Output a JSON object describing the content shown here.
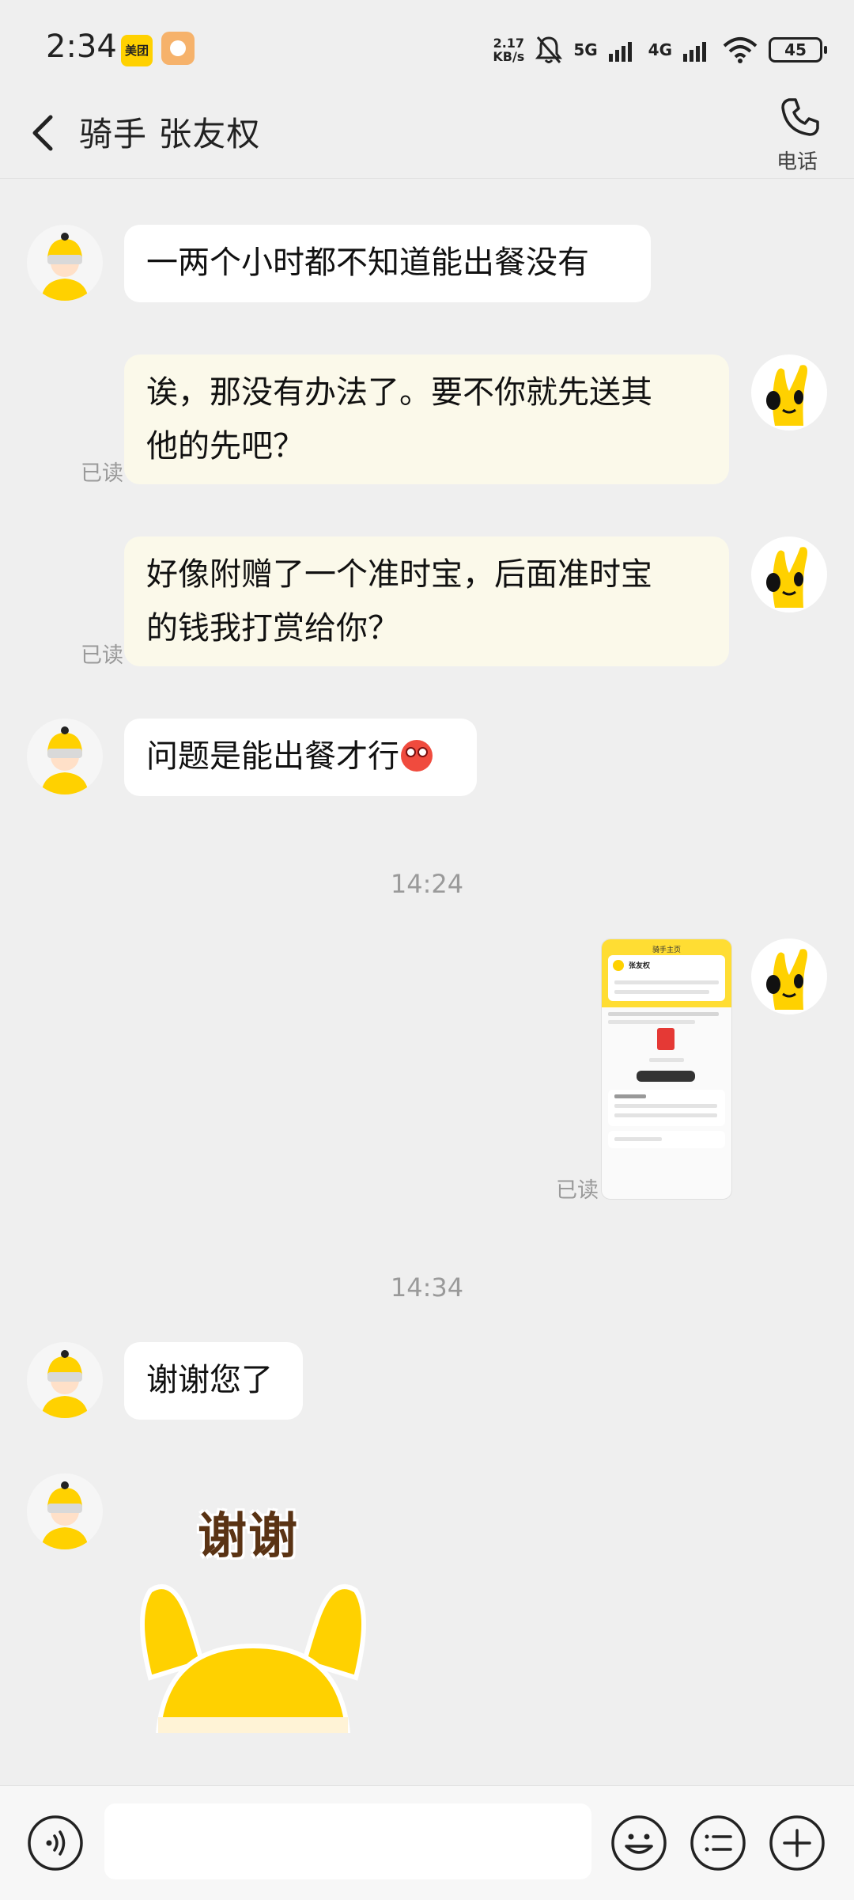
{
  "status_bar": {
    "time": "2:34",
    "app1": "美团",
    "speed_value": "2.17",
    "speed_unit": "KB/s",
    "net1": "5G",
    "net2": "4G",
    "battery": "45"
  },
  "header": {
    "title": "骑手 张友权",
    "call_label": "电话"
  },
  "messages": {
    "m1": "一两个小时都不知道能出餐没有",
    "m2_line1": "诶，那没有办法了。要不你就先送其",
    "m2_line2": "他的先吧？",
    "m2_read": "已读",
    "m3_line1": "好像附赠了一个准时宝，后面准时宝",
    "m3_line2": "的钱我打赏给你？",
    "m3_read": "已读",
    "m4": "问题是能出餐才行",
    "time1": "14:24",
    "img_read": "已读",
    "time2": "14:34",
    "m5": "谢谢您了",
    "sticker_text": "谢谢"
  },
  "thumbnail": {
    "title": "骑手主页",
    "name": "张友权"
  },
  "input": {
    "placeholder": ""
  }
}
